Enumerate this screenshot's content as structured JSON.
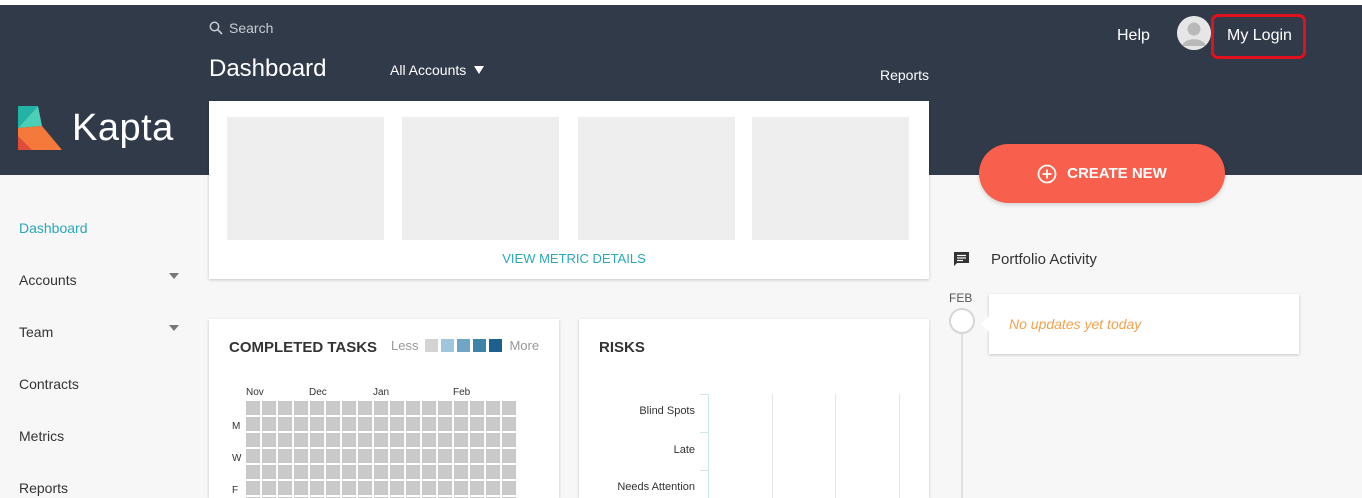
{
  "header": {
    "search_placeholder": "Search",
    "page_title": "Dashboard",
    "account_selector": "All Accounts",
    "reports_link": "Reports",
    "help_link": "Help",
    "login_link": "My Login",
    "brand": "Kapta"
  },
  "create_button": {
    "label": "CREATE NEW"
  },
  "sidebar": {
    "items": [
      {
        "label": "Dashboard",
        "active": true
      },
      {
        "label": "Accounts",
        "has_dropdown": true
      },
      {
        "label": "Team",
        "has_dropdown": true
      },
      {
        "label": "Contracts"
      },
      {
        "label": "Metrics"
      },
      {
        "label": "Reports"
      }
    ]
  },
  "metrics": {
    "link": "VIEW METRIC DETAILS"
  },
  "completed_tasks": {
    "title": "COMPLETED TASKS",
    "legend_less": "Less",
    "legend_more": "More",
    "legend_colors": [
      "#d3d3d3",
      "#9fc6dd",
      "#6fa5c5",
      "#3f83aa",
      "#1d6090"
    ],
    "months": [
      "Nov",
      "Dec",
      "Jan",
      "Feb"
    ],
    "days": [
      "M",
      "W",
      "F"
    ]
  },
  "risks": {
    "title": "RISKS",
    "categories": [
      "Blind Spots",
      "Late",
      "Needs Attention"
    ]
  },
  "activity": {
    "title": "Portfolio Activity",
    "month": "FEB",
    "empty_message": "No updates yet today"
  },
  "colors": {
    "header_bg": "#313a49",
    "accent_teal": "#2aa8b8",
    "create_button": "#f8604d",
    "highlight_red": "#e0101f",
    "update_text": "#f5a04a"
  }
}
